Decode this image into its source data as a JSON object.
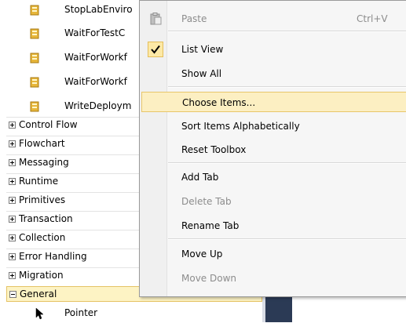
{
  "toolbox": {
    "items": [
      {
        "label": "StopLabEnviro",
        "icon": "activity-icon"
      },
      {
        "label": "WaitForTestC",
        "icon": "activity-icon"
      },
      {
        "label": "WaitForWorkf",
        "icon": "activity-icon"
      },
      {
        "label": "WaitForWorkf",
        "icon": "activity-icon"
      },
      {
        "label": "WriteDeploym",
        "icon": "activity-icon"
      }
    ],
    "categories": [
      {
        "label": "Control Flow",
        "expanded": false
      },
      {
        "label": "Flowchart",
        "expanded": false
      },
      {
        "label": "Messaging",
        "expanded": false
      },
      {
        "label": "Runtime",
        "expanded": false
      },
      {
        "label": "Primitives",
        "expanded": false
      },
      {
        "label": "Transaction",
        "expanded": false
      },
      {
        "label": "Collection",
        "expanded": false
      },
      {
        "label": "Error Handling",
        "expanded": false
      },
      {
        "label": "Migration",
        "expanded": false
      },
      {
        "label": "General",
        "expanded": true
      }
    ],
    "general_items": [
      {
        "label": "Pointer",
        "icon": "pointer-icon"
      }
    ]
  },
  "context_menu": {
    "items": [
      {
        "label": "Paste",
        "shortcut": "Ctrl+V",
        "enabled": false,
        "icon": "paste-icon"
      },
      {
        "label": "List View",
        "checked": true,
        "enabled": true
      },
      {
        "label": "Show All",
        "enabled": true
      },
      {
        "label": "Choose Items...",
        "enabled": true,
        "highlighted": true
      },
      {
        "label": "Sort Items Alphabetically",
        "enabled": true
      },
      {
        "label": "Reset Toolbox",
        "enabled": true
      },
      {
        "label": "Add Tab",
        "enabled": true
      },
      {
        "label": "Delete Tab",
        "enabled": false
      },
      {
        "label": "Rename Tab",
        "enabled": true
      },
      {
        "label": "Move Up",
        "enabled": true
      },
      {
        "label": "Move Down",
        "enabled": false
      }
    ]
  },
  "colors": {
    "selection_fill": "#fdf3c4",
    "selection_border": "#e5c365",
    "disabled_text": "#8c8c8c",
    "scrollbar_dark": "#2b3a55"
  }
}
